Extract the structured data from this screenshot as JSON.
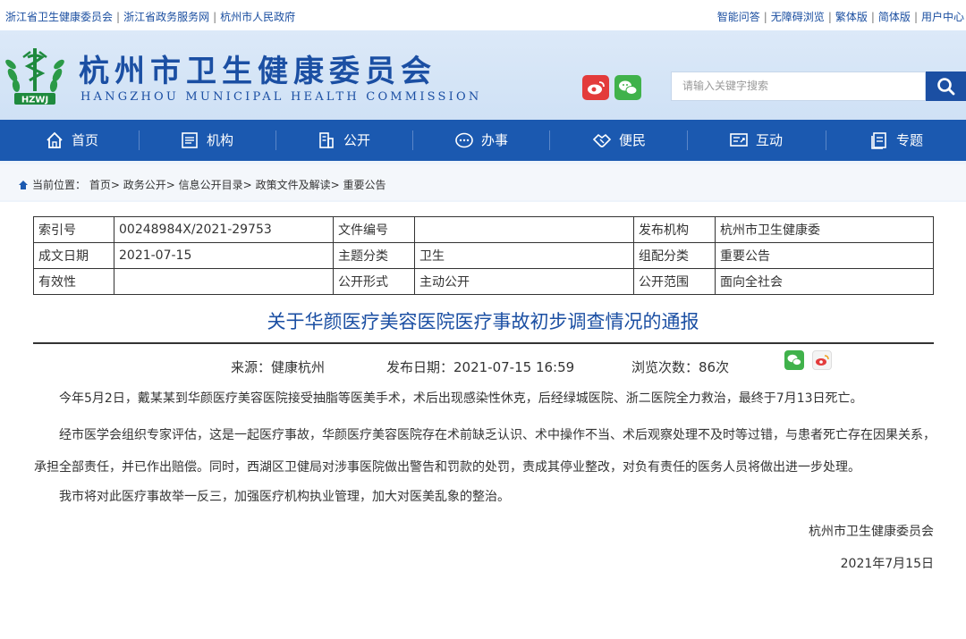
{
  "topbar": {
    "left_links": [
      "浙江省卫生健康委员会",
      "浙江省政务服务网",
      "杭州市人民政府"
    ],
    "right_links": [
      "智能问答",
      "无障碍浏览",
      "繁体版",
      "简体版",
      "用户中心"
    ]
  },
  "header": {
    "title": "杭州市卫生健康委员会",
    "subtitle": "HANGZHOU MUNICIPAL HEALTH COMMISSION",
    "logo_text": "HZWJ",
    "search_placeholder": "请输入关键字搜索"
  },
  "nav": {
    "items": [
      {
        "label": "首页",
        "icon": "home-icon"
      },
      {
        "label": "机构",
        "icon": "institution-icon"
      },
      {
        "label": "公开",
        "icon": "building-icon"
      },
      {
        "label": "办事",
        "icon": "chat-icon"
      },
      {
        "label": "便民",
        "icon": "handshake-icon"
      },
      {
        "label": "互动",
        "icon": "interaction-icon"
      },
      {
        "label": "专题",
        "icon": "topic-icon"
      }
    ]
  },
  "breadcrumb": {
    "prefix": "当前位置：",
    "items": [
      "首页",
      "政务公开",
      "信息公开目录",
      "政策文件及解读",
      "重要公告"
    ],
    "separator": ">"
  },
  "meta": {
    "rows": [
      [
        "索引号",
        "00248984X/2021-29753",
        "文件编号",
        "",
        "发布机构",
        "杭州市卫生健康委"
      ],
      [
        "成文日期",
        "2021-07-15",
        "主题分类",
        "卫生",
        "组配分类",
        "重要公告"
      ],
      [
        "有效性",
        "",
        "公开形式",
        "主动公开",
        "公开范围",
        "面向全社会"
      ]
    ]
  },
  "article": {
    "title": "关于华颜医疗美容医院医疗事故初步调查情况的通报",
    "source": "来源：健康杭州",
    "publish_date": "发布日期：2021-07-15 16:59",
    "views": "浏览次数：86次",
    "paragraphs": [
      "今年5月2日，戴某某到华颜医疗美容医院接受抽脂等医美手术，术后出现感染性休克，后经绿城医院、浙二医院全力救治，最终于7月13日死亡。",
      "经市医学会组织专家评估，这是一起医疗事故，华颜医疗美容医院存在术前缺乏认识、术中操作不当、术后观察处理不及时等过错，与患者死亡存在因果关系，承担全部责任，并已作出赔偿。同时，西湖区卫健局对涉事医院做出警告和罚款的处罚，责成其停业整改，对负有责任的医务人员将做出进一步处理。",
      "我市将对此医疗事故举一反三，加强医疗机构执业管理，加大对医美乱象的整治。"
    ],
    "signature": "杭州市卫生健康委员会",
    "signature_date": "2021年7月15日"
  },
  "colors": {
    "brand_blue": "#1b59b0",
    "title_blue": "#1b4fa3",
    "weibo_red": "#e33b3b",
    "wechat_green": "#40b24b"
  }
}
